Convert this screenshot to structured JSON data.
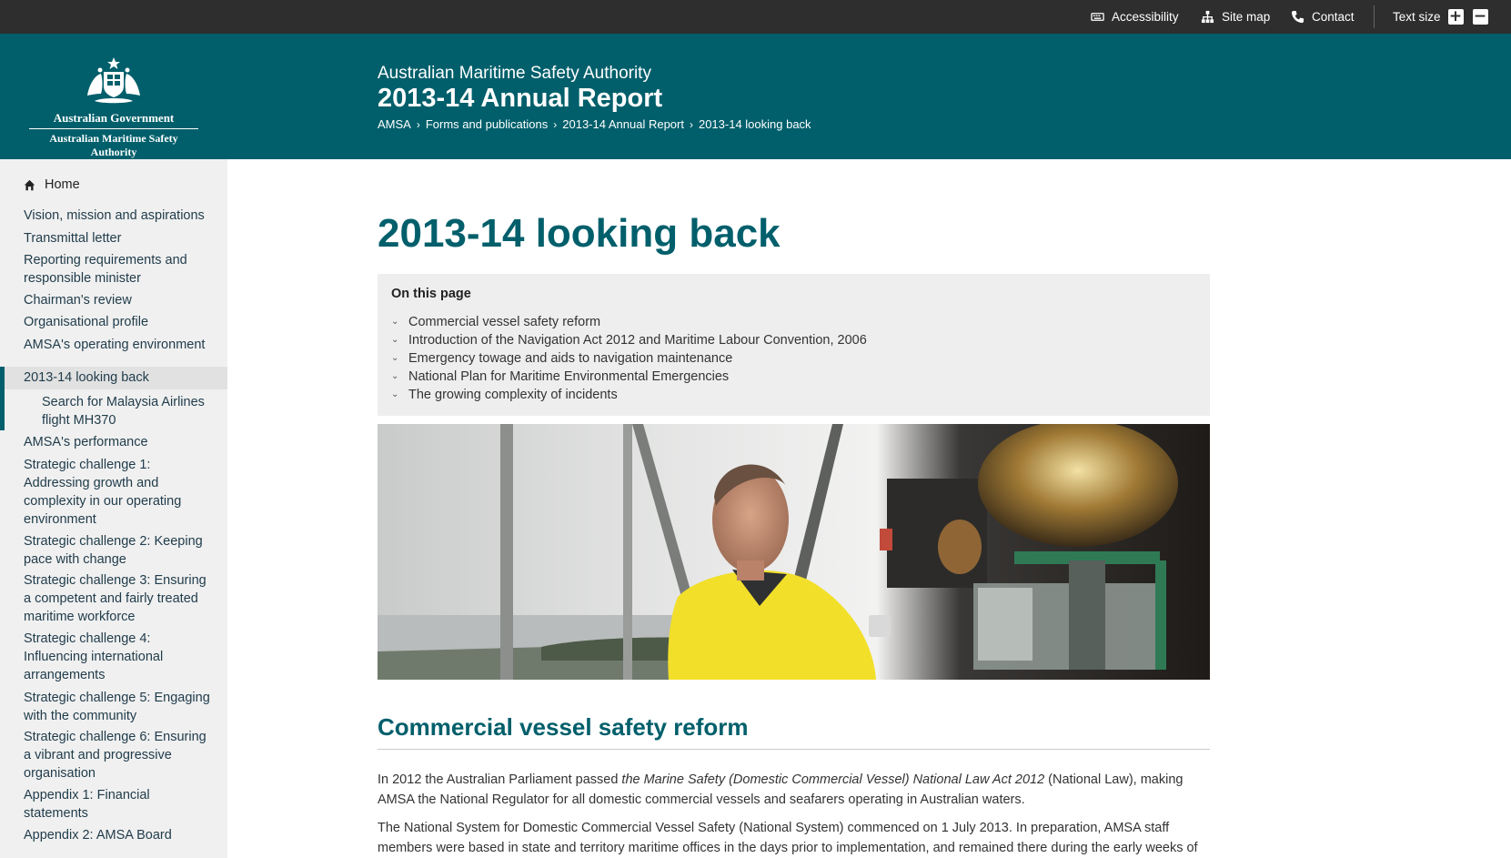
{
  "utility": {
    "accessibility": "Accessibility",
    "site_map": "Site map",
    "contact": "Contact",
    "text_size": "Text size",
    "increase": "+",
    "decrease": "−"
  },
  "masthead": {
    "crest_line1": "Australian Government",
    "crest_line2": "Australian Maritime Safety Authority",
    "org_name": "Australian Maritime Safety Authority",
    "report_title": "2013-14 Annual Report",
    "breadcrumb": [
      "AMSA",
      "Forms and publications",
      "2013-14 Annual Report",
      "2013-14 looking back"
    ],
    "breadcrumb_sep": "›"
  },
  "sidebar": {
    "home": "Home",
    "items": [
      "Vision, mission and aspirations",
      "Transmittal letter",
      "Reporting requirements and responsible minister",
      "Chairman's review",
      "Organisational profile",
      "AMSA's operating environment",
      "2013-14 looking back",
      "Search for Malaysia Airlines flight MH370",
      "AMSA's performance",
      "Strategic challenge 1: Addressing growth and complexity in our operating environment",
      "Strategic challenge 2: Keeping pace with change",
      "Strategic challenge 3: Ensuring a competent and fairly treated maritime workforce",
      "Strategic challenge 4: Influencing international arrangements",
      "Strategic challenge 5: Engaging with the community",
      "Strategic challenge 6: Ensuring a vibrant and progressive organisation",
      "Appendix 1: Financial statements",
      "Appendix 2: AMSA Board"
    ],
    "active_index": 6
  },
  "main": {
    "page_title": "2013-14 looking back",
    "on_this_page": {
      "heading": "On this page",
      "links": [
        "Commercial vessel safety reform",
        "Introduction of the Navigation Act 2012 and Maritime Labour Convention, 2006",
        "Emergency towage and aids to navigation maintenance",
        "National Plan for Maritime Environmental Emergencies",
        "The growing complexity of incidents"
      ]
    },
    "section_title": "Commercial vessel safety reform",
    "para1_a": "In 2012 the Australian Parliament passed ",
    "para1_em": "the Marine Safety (Domestic Commercial Vessel) National Law Act 2012",
    "para1_b": " (National Law), making AMSA the National Regulator for all domestic commercial vessels and seafarers operating in Australian waters.",
    "para2": "The National System for Domestic Commercial Vessel Safety (National System) commenced on 1 July 2013. In preparation, AMSA staff members were based in state and territory maritime offices in the days prior to implementation, and remained there during the early weeks of"
  },
  "colors": {
    "brand_teal": "#005f6b",
    "utility_bar": "#2e2e2e",
    "sidebar_bg": "#f0f0f0"
  }
}
